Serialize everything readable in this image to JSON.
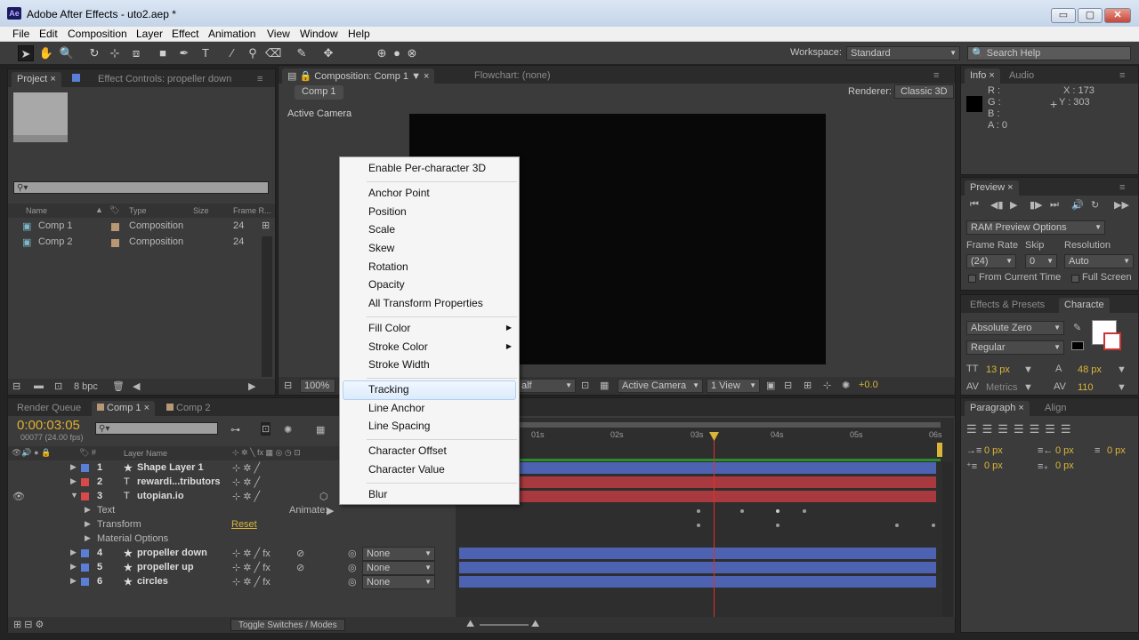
{
  "window": {
    "app_icon": "Ae",
    "title": "Adobe After Effects - uto2.aep *",
    "minimize": "▭",
    "maximize": "▢",
    "close": "✕"
  },
  "menu": [
    "File",
    "Edit",
    "Composition",
    "Layer",
    "Effect",
    "Animation",
    "View",
    "Window",
    "Help"
  ],
  "toolbar": {
    "workspace_label": "Workspace:",
    "workspace_value": "Standard",
    "search_placeholder": "Search Help"
  },
  "project": {
    "tab_project": "Project",
    "tab_effect_controls": "Effect Controls: propeller down",
    "columns": {
      "name": "Name",
      "type": "Type",
      "size": "Size",
      "frame_rate": "Frame R..."
    },
    "items": [
      {
        "name": "Comp 1",
        "type": "Composition",
        "frame_rate": "24"
      },
      {
        "name": "Comp 2",
        "type": "Composition",
        "frame_rate": "24"
      }
    ],
    "bpc": "8 bpc"
  },
  "composition": {
    "tab": "Composition: Comp 1",
    "tab_flowchart": "Flowchart: (none)",
    "subtab": "Comp 1",
    "renderer_label": "Renderer:",
    "renderer_value": "Classic 3D",
    "active_camera": "Active Camera",
    "zoom": "100%",
    "resolution_partial": "alf",
    "camera_dropdown": "Active Camera",
    "view_dropdown": "1 View",
    "exposure": "+0.0"
  },
  "info": {
    "tab_info": "Info",
    "tab_audio": "Audio",
    "r": "R :",
    "g": "G :",
    "b": "B :",
    "a": "A : 0",
    "x": "X : 173",
    "y": "Y : 303"
  },
  "preview": {
    "tab": "Preview",
    "ram_options": "RAM Preview Options",
    "frame_rate_label": "Frame Rate",
    "skip_label": "Skip",
    "resolution_label": "Resolution",
    "frame_rate_value": "(24)",
    "skip_value": "0",
    "resolution_value": "Auto",
    "from_current": "From Current Time",
    "full_screen": "Full Screen"
  },
  "effects_tabs": {
    "effects": "Effects & Presets",
    "character": "Characte"
  },
  "character": {
    "font": "Absolute Zero",
    "style": "Regular",
    "size": "13 px",
    "leading": "48 px",
    "kerning": "Metrics",
    "tracking": "110"
  },
  "paragraph": {
    "tab_paragraph": "Paragraph",
    "tab_align": "Align",
    "values": [
      "0 px",
      "0 px",
      "0 px",
      "0 px",
      "0 px"
    ]
  },
  "context_menu": {
    "items": [
      "Enable Per-character 3D",
      "Anchor Point",
      "Position",
      "Scale",
      "Skew",
      "Rotation",
      "Opacity",
      "All Transform Properties",
      "Fill Color",
      "Stroke Color",
      "Stroke Width",
      "Tracking",
      "Line Anchor",
      "Line Spacing",
      "Character Offset",
      "Character Value",
      "Blur"
    ],
    "highlighted": "Tracking"
  },
  "timeline": {
    "tab_render_queue": "Render Queue",
    "tab_comp1": "Comp 1",
    "tab_comp2": "Comp 2",
    "timecode": "0:00:03:05",
    "frame_info": "00077 (24.00 fps)",
    "layer_name_header": "Layer Name",
    "layers": [
      {
        "num": "1",
        "name": "Shape Layer 1",
        "color": "#5b7fd6"
      },
      {
        "num": "2",
        "name": "rewardi...tributors",
        "color": "#d84a4a"
      },
      {
        "num": "3",
        "name": "utopian.io",
        "color": "#d84a4a"
      },
      {
        "num": "4",
        "name": "propeller down",
        "color": "#5b7fd6",
        "parent": "None"
      },
      {
        "num": "5",
        "name": "propeller up",
        "color": "#5b7fd6",
        "parent": "None"
      },
      {
        "num": "6",
        "name": "circles",
        "color": "#5b7fd6",
        "parent": "None"
      }
    ],
    "props": {
      "text": "Text",
      "transform": "Transform",
      "material": "Material Options",
      "animate": "Animate:",
      "reset": "Reset"
    },
    "ruler": [
      "01s",
      "02s",
      "03s",
      "04s",
      "05s",
      "06s"
    ],
    "toggle": "Toggle Switches / Modes"
  }
}
